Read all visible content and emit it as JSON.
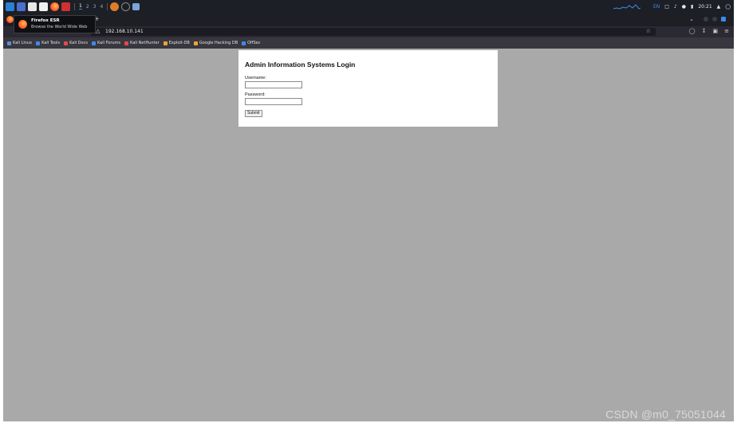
{
  "taskbar": {
    "workspaces": [
      "1",
      "2",
      "3",
      "4"
    ],
    "language": "EN",
    "time": "20:21"
  },
  "tooltip": {
    "title": "Firefox ESR",
    "subtitle": "Browse the World Wide Web"
  },
  "tabs": {
    "new_tab": "+"
  },
  "navbar": {
    "url": "192.168.10.141"
  },
  "bookmarks": [
    {
      "label": "Kali Linux",
      "color": "#5b8fd6"
    },
    {
      "label": "Kali Tools",
      "color": "#3d8be8"
    },
    {
      "label": "Kali Docs",
      "color": "#e24a4a"
    },
    {
      "label": "Kali Forums",
      "color": "#3d8be8"
    },
    {
      "label": "Kali NetHunter",
      "color": "#e24a4a"
    },
    {
      "label": "Exploit-DB",
      "color": "#f0a23a"
    },
    {
      "label": "Google Hacking DB",
      "color": "#f0a23a"
    },
    {
      "label": "OffSec",
      "color": "#3d8be8"
    }
  ],
  "login": {
    "title": "Admin Information Systems Login",
    "username_label": "Username:",
    "username_value": "",
    "password_label": "Password:",
    "password_value": "",
    "submit_label": "Submit"
  },
  "watermark": "CSDN @m0_75051044",
  "colors": {
    "page_background": "#a9a9a9",
    "accent": "#3d8be8"
  }
}
